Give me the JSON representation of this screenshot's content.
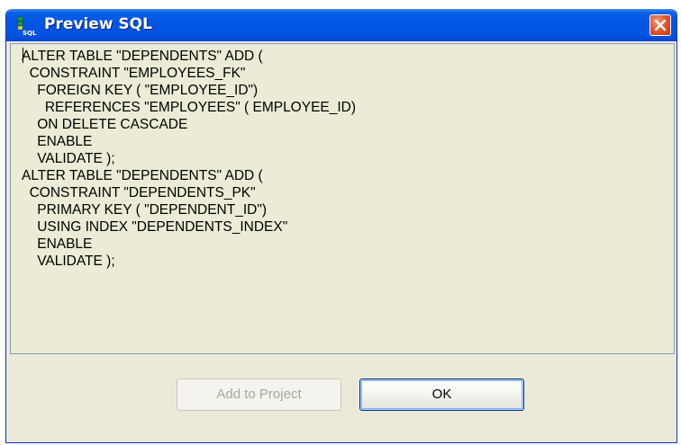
{
  "dialog": {
    "title": "Preview SQL",
    "icon": "sql-icon",
    "close_icon": "close-icon"
  },
  "sql": {
    "lines": [
      "ALTER TABLE \"DEPENDENTS\" ADD (",
      "  CONSTRAINT \"EMPLOYEES_FK\"",
      "    FOREIGN KEY ( \"EMPLOYEE_ID\")",
      "      REFERENCES \"EMPLOYEES\" ( EMPLOYEE_ID)",
      "    ON DELETE CASCADE",
      "    ENABLE",
      "    VALIDATE );",
      "ALTER TABLE \"DEPENDENTS\" ADD (",
      "  CONSTRAINT \"DEPENDENTS_PK\"",
      "    PRIMARY KEY ( \"DEPENDENT_ID\")",
      "    USING INDEX \"DEPENDENTS_INDEX\"",
      "    ENABLE",
      "    VALIDATE );"
    ]
  },
  "buttons": {
    "add_to_project": "Add to Project",
    "ok": "OK"
  },
  "colors": {
    "titlebar": "#0054e3",
    "close": "#e2582f",
    "dialog_bg": "#ece9d8"
  }
}
